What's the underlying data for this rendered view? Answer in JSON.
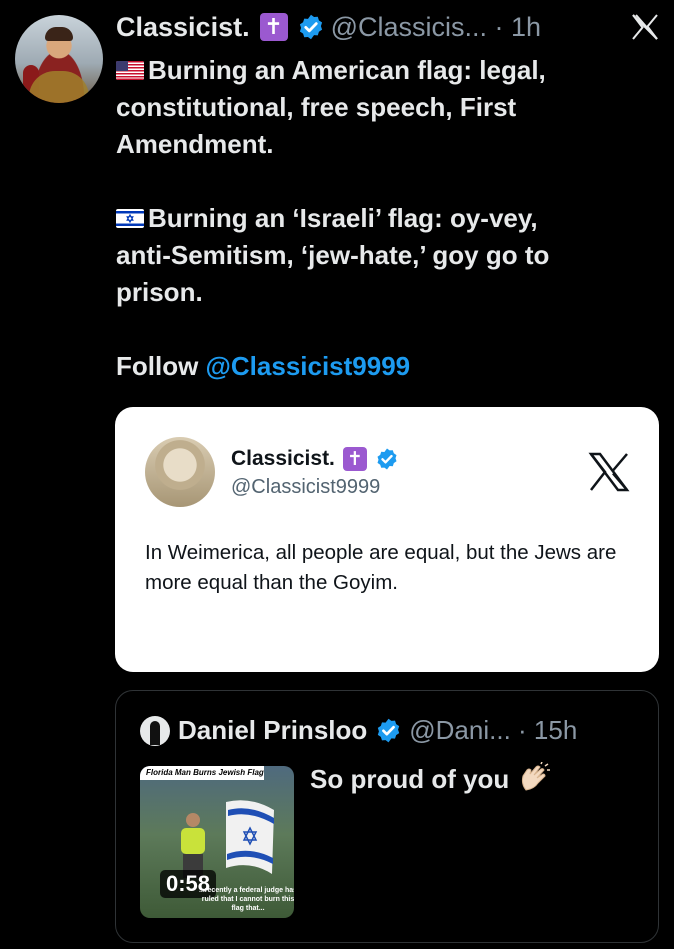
{
  "post": {
    "author_name": "Classicist.",
    "cross_badge": "✝",
    "handle_time": "@Classicis... · 1h",
    "close_icon": "x-logo-icon",
    "lines": [
      "Burning an American flag: legal,",
      "constitutional, free speech, First",
      "Amendment.",
      "",
      "Burning an ‘Israeli’ flag: oy-vey,",
      "anti-Semitism, ‘jew-hate,’ goy go to",
      "prison.",
      "",
      "Follow "
    ],
    "mention": "@Classicist9999"
  },
  "quoted_card": {
    "author_name": "Classicist.",
    "cross_badge": "✝",
    "handle": "@Classicist9999",
    "text": "In Weimerica, all people are equal, but the Jews are more equal than the Goyim.",
    "logo_icon": "x-logo-icon"
  },
  "nested_quote": {
    "author_name": "Daniel Prinsloo",
    "handle_time": "@Dani... · 15h",
    "text": "So proud of you",
    "emoji_icon": "clapping-hands-icon",
    "video": {
      "banner": "Florida Man Burns Jewish Flag",
      "duration": "0:58",
      "caption": "...recently a federal judge has ruled that I cannot burn this flag that..."
    }
  },
  "colors": {
    "background": "#000000",
    "text": "#e7e9ea",
    "secondary": "#8b98a5",
    "link": "#1d9bf0",
    "verified": "#1d9bf0",
    "badge_purple": "#9b59d0"
  }
}
